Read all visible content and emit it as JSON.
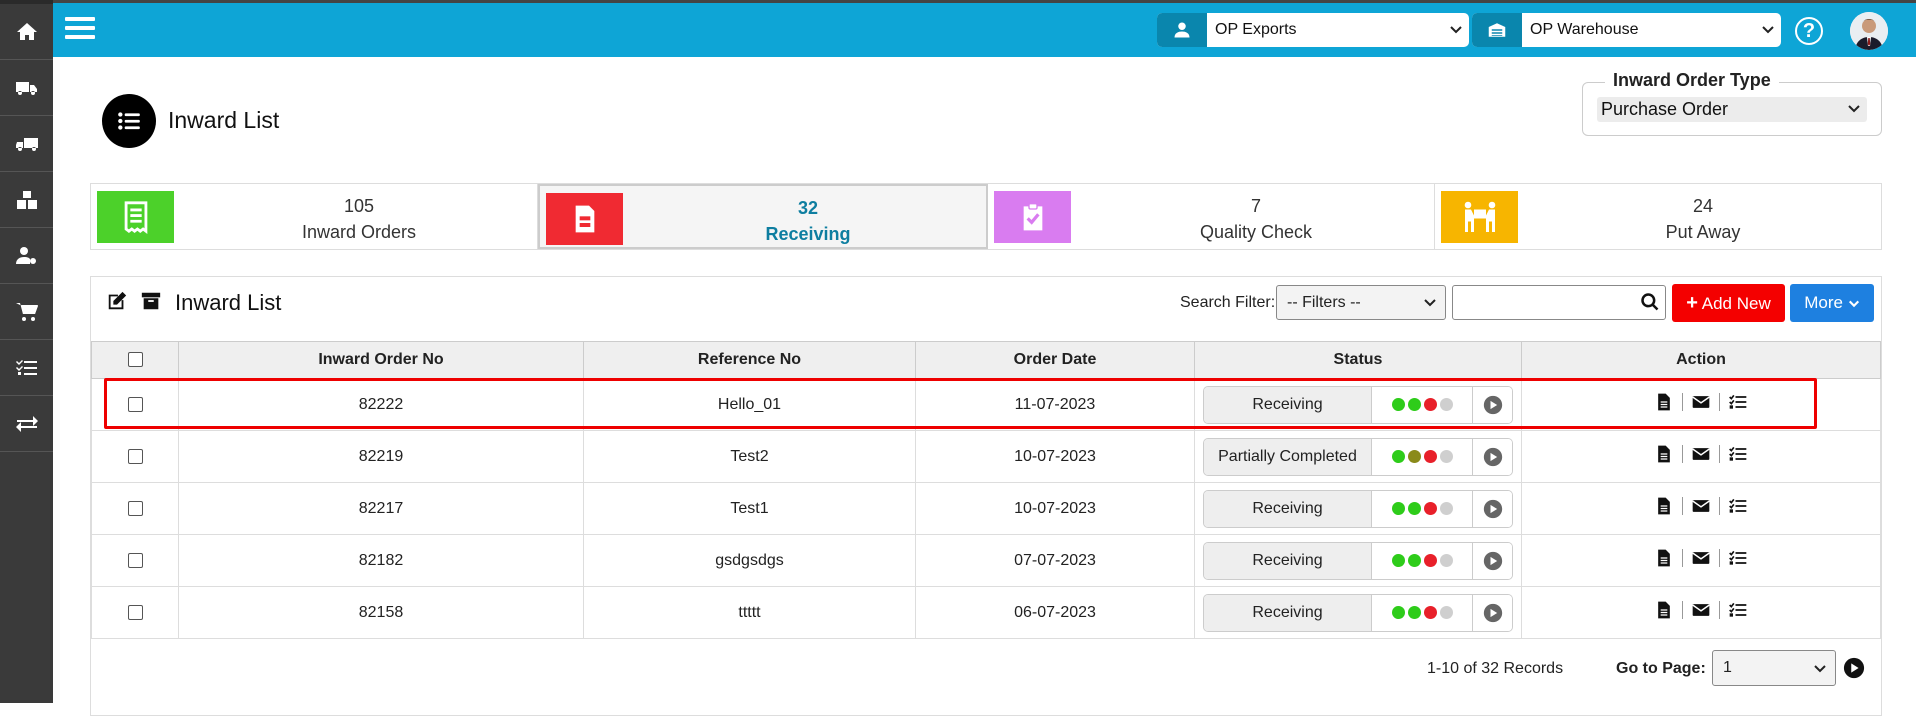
{
  "header": {
    "company_select": "OP Exports",
    "warehouse_select": "OP Warehouse",
    "help_label": "?"
  },
  "sidebar": {
    "items": [
      {
        "icon": "home-icon"
      },
      {
        "icon": "delivery-truck-icon"
      },
      {
        "icon": "truck-icon"
      },
      {
        "icon": "boxes-icon"
      },
      {
        "icon": "user-settings-icon"
      },
      {
        "icon": "cart-icon"
      },
      {
        "icon": "checklist-icon"
      },
      {
        "icon": "transfer-icon"
      }
    ]
  },
  "page": {
    "title": "Inward List"
  },
  "order_type": {
    "label": "Inward Order Type",
    "value": "Purchase Order"
  },
  "stats": [
    {
      "count": "105",
      "label": "Inward Orders",
      "color": "#4cd12a"
    },
    {
      "count": "32",
      "label": "Receiving",
      "color": "#f02a32"
    },
    {
      "count": "7",
      "label": "Quality Check",
      "color": "#d97cf0"
    },
    {
      "count": "24",
      "label": "Put Away",
      "color": "#f7b500"
    }
  ],
  "list": {
    "title": "Inward List",
    "search_label": "Search Filter:",
    "filter_value": "-- Filters --",
    "search_placeholder": "",
    "add_new_label": "Add New",
    "more_label": "More"
  },
  "table": {
    "columns": [
      "Inward Order No",
      "Reference No",
      "Order Date",
      "Status",
      "Action"
    ],
    "rows": [
      {
        "order_no": "82222",
        "reference": "Hello_01",
        "date": "11-07-2023",
        "status": "Receiving",
        "dots": [
          "#2ecc1a",
          "#2ecc1a",
          "#e8202a",
          "#cfcfcf"
        ]
      },
      {
        "order_no": "82219",
        "reference": "Test2",
        "date": "10-07-2023",
        "status": "Partially Completed",
        "dots": [
          "#2ecc1a",
          "#8a8a1a",
          "#e8202a",
          "#cfcfcf"
        ]
      },
      {
        "order_no": "82217",
        "reference": "Test1",
        "date": "10-07-2023",
        "status": "Receiving",
        "dots": [
          "#2ecc1a",
          "#2ecc1a",
          "#e8202a",
          "#cfcfcf"
        ]
      },
      {
        "order_no": "82182",
        "reference": "gsdgsdgs",
        "date": "07-07-2023",
        "status": "Receiving",
        "dots": [
          "#2ecc1a",
          "#2ecc1a",
          "#e8202a",
          "#cfcfcf"
        ]
      },
      {
        "order_no": "82158",
        "reference": "ttttt",
        "date": "06-07-2023",
        "status": "Receiving",
        "dots": [
          "#2ecc1a",
          "#2ecc1a",
          "#e8202a",
          "#cfcfcf"
        ]
      }
    ]
  },
  "footer": {
    "records": "1-10 of 32 Records",
    "goto_label": "Go to Page:",
    "page_value": "1"
  }
}
